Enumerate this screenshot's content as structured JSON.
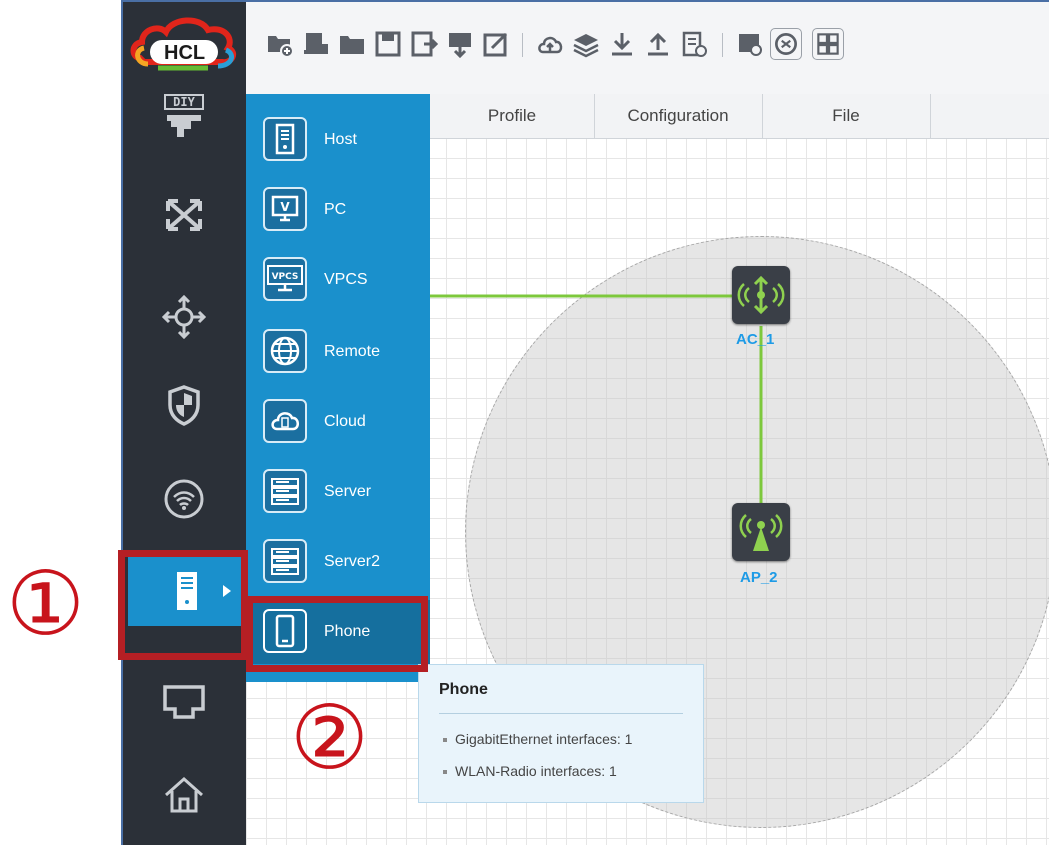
{
  "app": {
    "logo_text": "HCL"
  },
  "sidebar": {
    "items": [
      {
        "name": "diy",
        "icon": "diy-icon"
      },
      {
        "name": "topology",
        "icon": "shuffle-icon"
      },
      {
        "name": "router",
        "icon": "router-icon"
      },
      {
        "name": "security",
        "icon": "shield-icon"
      },
      {
        "name": "wireless",
        "icon": "wifi-icon"
      },
      {
        "name": "terminal",
        "icon": "host-icon",
        "selected": true
      },
      {
        "name": "connection",
        "icon": "cable-icon"
      },
      {
        "name": "home",
        "icon": "home-icon"
      }
    ]
  },
  "tabs": {
    "profile": "Profile",
    "configuration": "Configuration",
    "file": "File"
  },
  "menu": {
    "items": [
      {
        "label": "Host",
        "icon": "host-icon"
      },
      {
        "label": "PC",
        "icon": "pc-icon"
      },
      {
        "label": "VPCS",
        "icon": "vpcs-icon",
        "icon_text": "VPCS"
      },
      {
        "label": "Remote",
        "icon": "globe-icon"
      },
      {
        "label": "Cloud",
        "icon": "cloud-icon"
      },
      {
        "label": "Server",
        "icon": "server-icon"
      },
      {
        "label": "Server2",
        "icon": "server-icon"
      },
      {
        "label": "Phone",
        "icon": "phone-icon",
        "highlighted": true
      }
    ]
  },
  "canvas": {
    "nodes": [
      {
        "name": "AC_1",
        "icon": "ac-icon"
      },
      {
        "name": "AP_2",
        "icon": "ap-icon"
      }
    ]
  },
  "tooltip": {
    "title": "Phone",
    "lines": [
      "GigabitEthernet interfaces: 1",
      "WLAN-Radio interfaces: 1"
    ]
  },
  "callouts": {
    "step1": "①",
    "step2": "②"
  },
  "colors": {
    "sidebar": "#2b3038",
    "menu": "#1a90cc",
    "accent_green": "#7dc83c",
    "callout_red": "#b51f24",
    "node_label": "#1e9be6"
  }
}
